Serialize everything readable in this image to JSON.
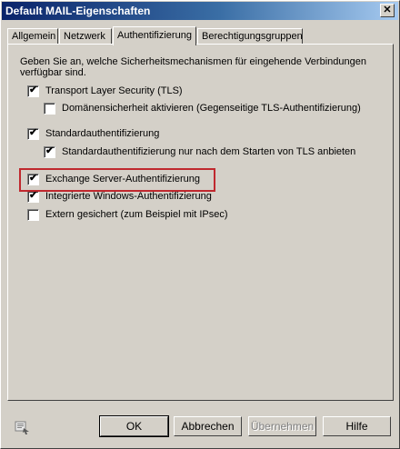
{
  "window": {
    "title": "Default MAIL-Eigenschaften"
  },
  "tabs": [
    {
      "label": "Allgemein"
    },
    {
      "label": "Netzwerk"
    },
    {
      "label": "Authentifizierung"
    },
    {
      "label": "Berechtigungsgruppen"
    }
  ],
  "active_tab": "Authentifizierung",
  "panel": {
    "description": "Geben Sie an, welche Sicherheitsmechanismen für eingehende Verbindungen verfügbar sind.",
    "options": [
      {
        "label": "Transport Layer Security (TLS)",
        "checked": true
      },
      {
        "label": "Domänensicherheit aktivieren (Gegenseitige TLS-Authentifizierung)",
        "checked": false
      },
      {
        "label": "Standardauthentifizierung",
        "checked": true
      },
      {
        "label": "Standardauthentifizierung nur nach dem Starten von TLS anbieten",
        "checked": true
      },
      {
        "label": "Exchange Server-Authentifizierung",
        "checked": true
      },
      {
        "label": "Integrierte Windows-Authentifizierung",
        "checked": true
      },
      {
        "label": "Extern gesichert (zum Beispiel mit IPsec)",
        "checked": false
      }
    ]
  },
  "buttons": {
    "ok": "OK",
    "cancel": "Abbrechen",
    "apply": "Übernehmen",
    "help": "Hilfe"
  },
  "colors": {
    "highlight": "#c0282e",
    "titlebar": "#0a246a"
  }
}
